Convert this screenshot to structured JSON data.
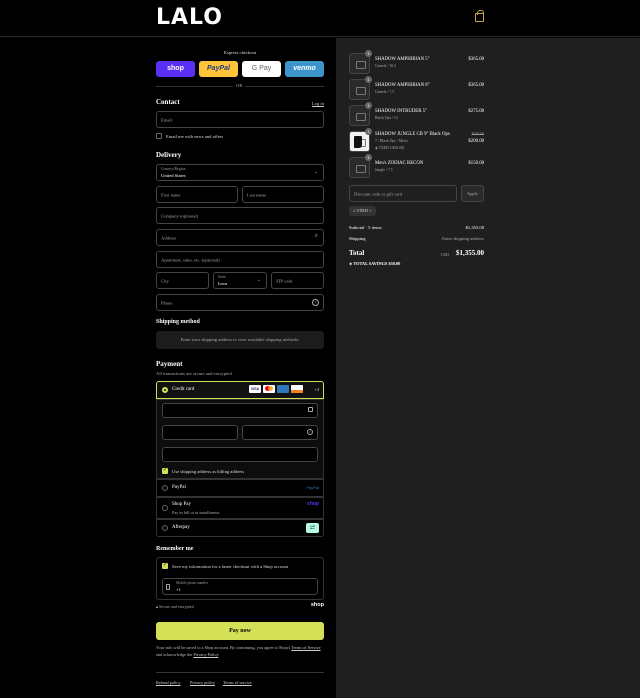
{
  "header": {
    "logo": "LALO",
    "cart_icon": "shopping-bag-icon"
  },
  "express": {
    "title": "Express checkout",
    "buttons": [
      "shop",
      "PayPal",
      "G Pay",
      "venmo"
    ],
    "or": "OR"
  },
  "contact": {
    "title": "Contact",
    "login": "Log in",
    "email_placeholder": "Email",
    "newsletter": "Email me with news and offers"
  },
  "delivery": {
    "title": "Delivery",
    "country_label": "Country/Region",
    "country_value": "United States",
    "first_name": "First name",
    "last_name": "Last name",
    "company": "Company (optional)",
    "address": "Address",
    "apartment": "Apartment, suite, etc. (optional)",
    "city": "City",
    "state_label": "State",
    "state_value": "Iowa",
    "zip": "ZIP code",
    "phone": "Phone"
  },
  "shipping": {
    "title": "Shipping method",
    "message": "Enter your shipping address to view available shipping methods."
  },
  "payment": {
    "title": "Payment",
    "subtitle": "All transactions are secure and encrypted.",
    "credit_card": "Credit card",
    "more_cards": "+3",
    "billing_same": "Use shipping address as billing address",
    "paypal": "PayPal",
    "shop_pay": "Shop Pay",
    "shop_pay_sub": "Pay in full or in installments",
    "afterpay": "Afterpay"
  },
  "remember": {
    "title": "Remember me",
    "save_info": "Save my information for a faster checkout with a Shop account",
    "mobile_label": "Mobile phone number",
    "mobile_value": "+1",
    "secure": "Secure and encrypted",
    "shop_logo": "shop"
  },
  "pay_button": "Pay now",
  "legal": {
    "text": "Your info will be saved to a Shop account. By continuing, you agree to Shop's",
    "terms": "Terms of Service",
    "and": "and acknowledge the",
    "privacy": "Privacy Policy",
    "period": "."
  },
  "footer": {
    "links": [
      "Refund policy",
      "Privacy policy",
      "Terms of service"
    ]
  },
  "cart": {
    "items": [
      {
        "qty": "1",
        "name": "SHADOW AMPHIBIAN 5\"",
        "variant": "Camels / 10.5",
        "price": "$365.00"
      },
      {
        "qty": "1",
        "name": "SHADOW AMPHIBIAN 8\"",
        "variant": "Camels / 7.5",
        "price": "$365.00"
      },
      {
        "qty": "1",
        "name": "SHADOW INTRUDER 5\"",
        "variant": "Black Ops / 14",
        "price": "$275.00"
      },
      {
        "qty": "1",
        "name": "SHADOW JUNGLE CB 9\" Black Ops",
        "variant": "7 / Black Ops / Men's",
        "discount": "TXED (-$50.00)",
        "old_price": "$250.00",
        "price": "$200.00"
      },
      {
        "qty": "1",
        "name": "Men's ZODIAC RECON",
        "variant": "Jungle / 7.5",
        "price": "$150.00"
      }
    ],
    "discount_placeholder": "Discount code or gift card",
    "apply": "Apply",
    "code_tag": "TXED",
    "subtotal_label": "Subtotal · 5 items",
    "subtotal_value": "$1,355.00",
    "shipping_label": "Shipping",
    "shipping_value": "Enter shipping address",
    "total_label": "Total",
    "currency": "USD",
    "total_value": "$1,355.00",
    "savings_label": "TOTAL SAVINGS",
    "savings_value": "$50.00"
  }
}
